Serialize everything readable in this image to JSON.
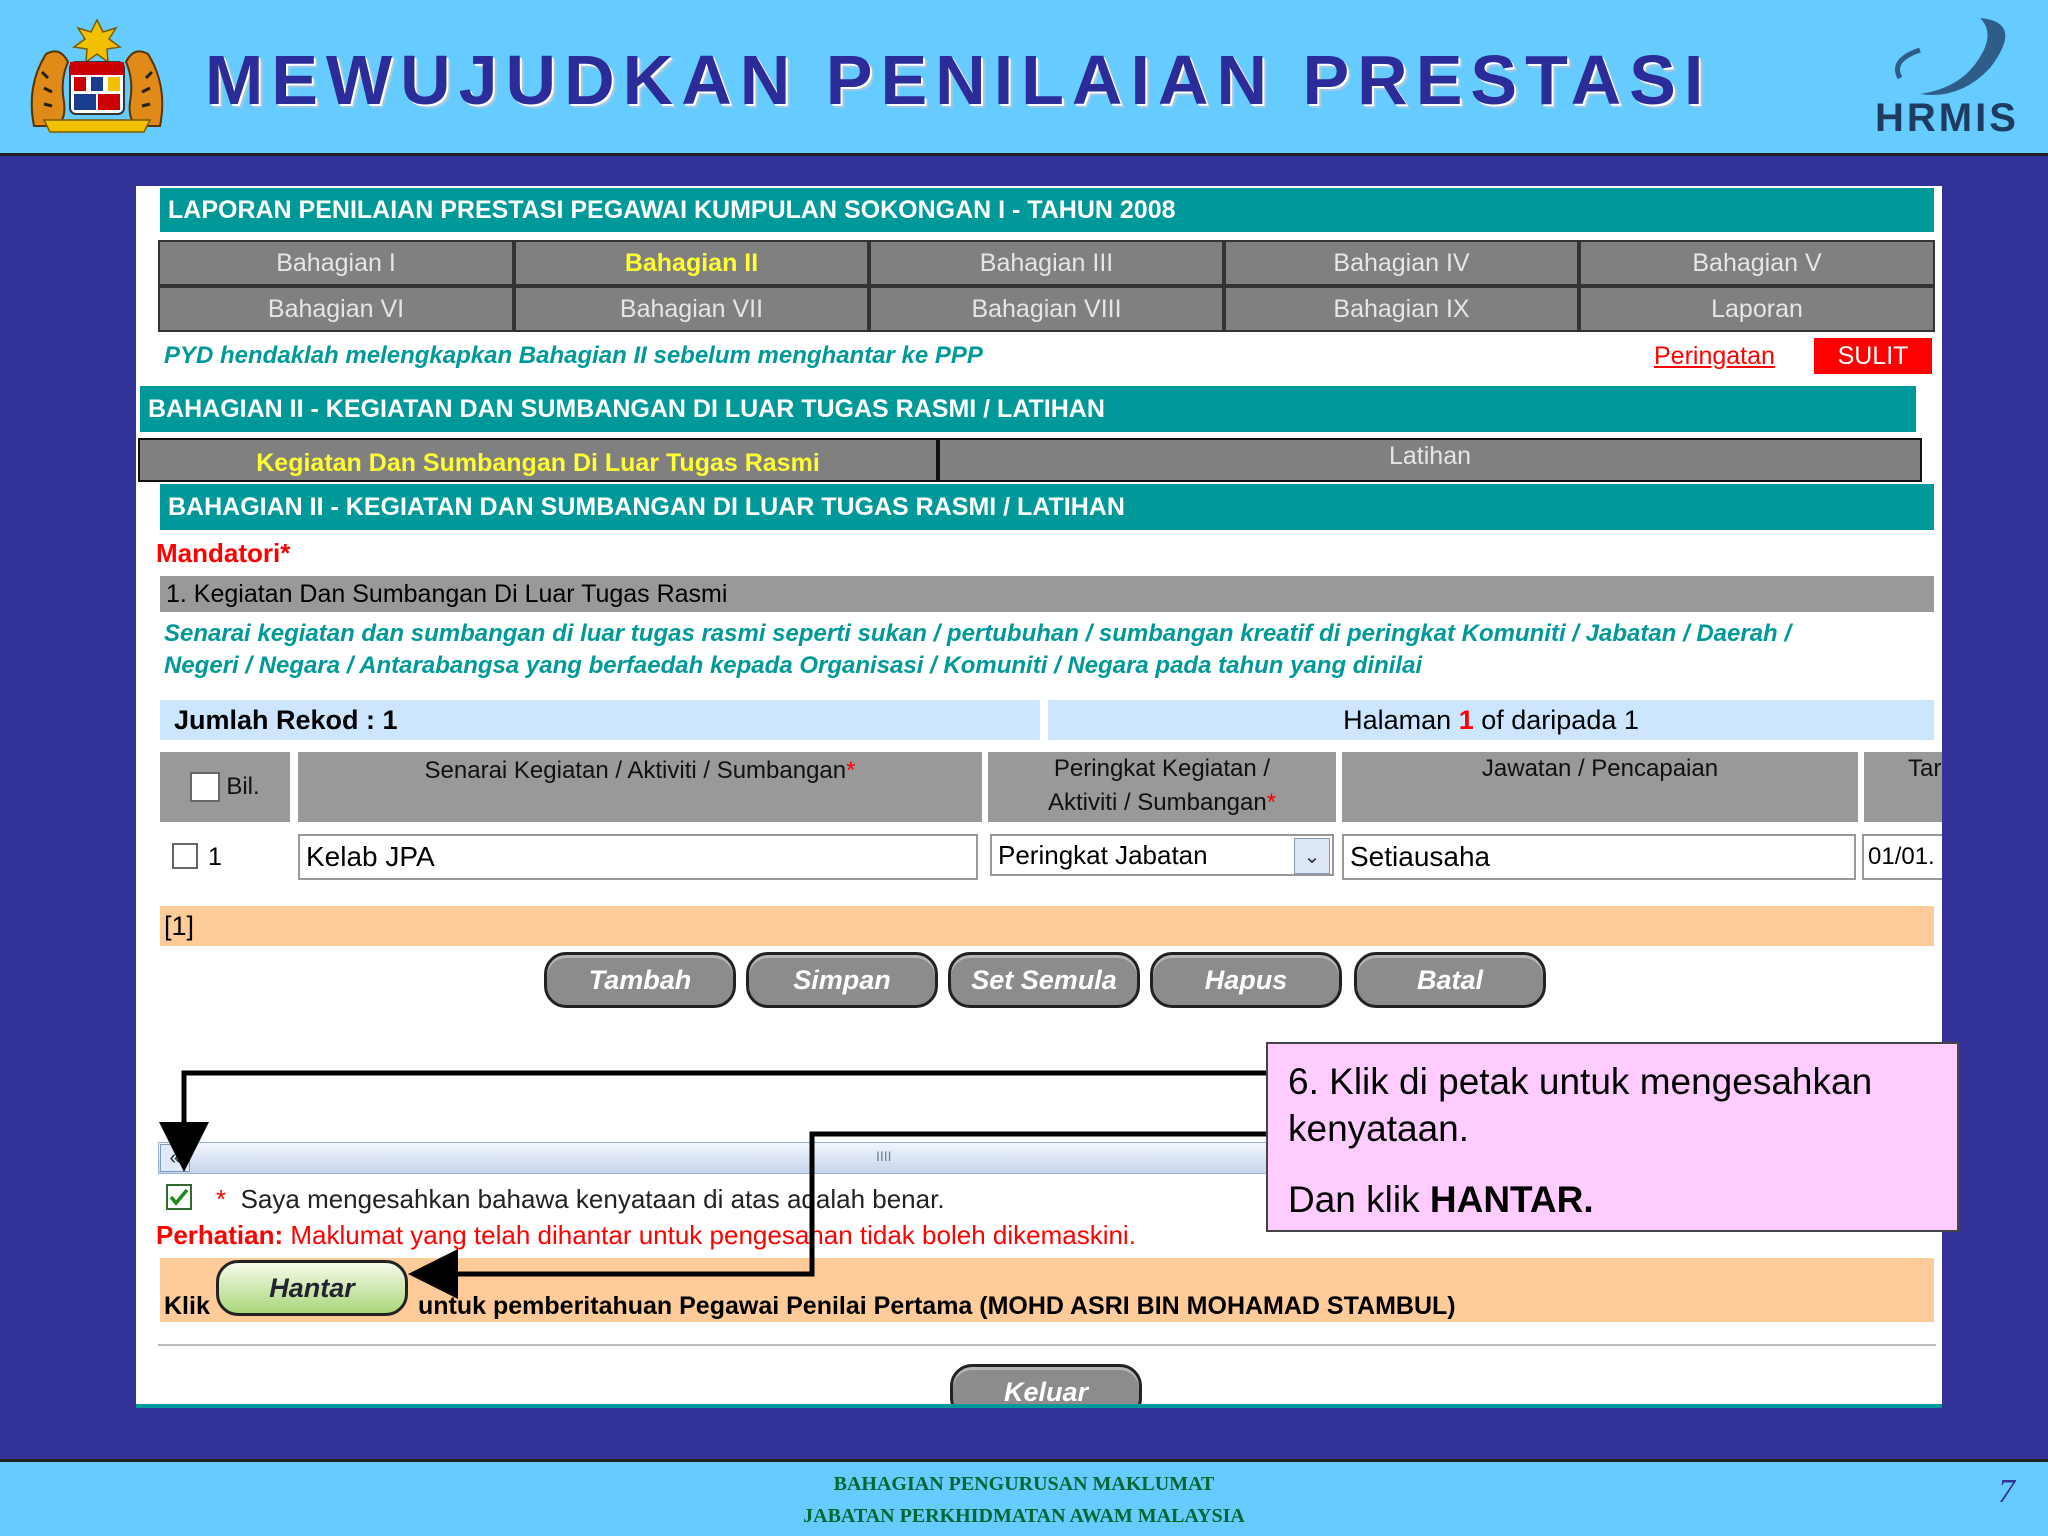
{
  "slide": {
    "title": "MEWUJUDKAN PENILAIAN PRESTASI",
    "logo_right": "HRMIS",
    "footer_line1": "BAHAGIAN PENGURUSAN MAKLUMAT",
    "footer_line2": "JABATAN PERKHIDMATAN AWAM MALAYSIA",
    "page_number": "7"
  },
  "form": {
    "main_title": "LAPORAN PENILAIAN PRESTASI PEGAWAI KUMPULAN SOKONGAN I - TAHUN 2008",
    "tabs_row1": [
      "Bahagian I",
      "Bahagian II",
      "Bahagian III",
      "Bahagian IV",
      "Bahagian V"
    ],
    "tabs_row2": [
      "Bahagian VI",
      "Bahagian VII",
      "Bahagian VIII",
      "Bahagian IX",
      "Laporan"
    ],
    "instruction": "PYD hendaklah melengkapkan Bahagian II sebelum menghantar ke PPP",
    "peringatan_link": "Peringatan",
    "sulit_label": "SULIT",
    "section_header": "BAHAGIAN II - KEGIATAN DAN SUMBANGAN DI LUAR TUGAS RASMI / LATIHAN",
    "subtabs": [
      "Kegiatan Dan Sumbangan Di Luar Tugas Rasmi",
      "Latihan"
    ],
    "section_header2": "BAHAGIAN II - KEGIATAN DAN SUMBANGAN DI LUAR TUGAS RASMI / LATIHAN",
    "mandatori": "Mandatori*",
    "subsection_title": "1. Kegiatan Dan Sumbangan Di Luar Tugas Rasmi",
    "description_line1": "Senarai kegiatan dan sumbangan di luar tugas rasmi seperti sukan / pertubuhan / sumbangan kreatif di peringkat Komuniti / Jabatan / Daerah /",
    "description_line2": "Negeri / Negara / Antarabangsa yang berfaedah kepada Organisasi / Komuniti / Negara pada tahun yang dinilai",
    "record_count": "Jumlah Rekod : 1",
    "pagination_pre": "Halaman",
    "pagination_current": "1",
    "pagination_post": "of daripada 1",
    "table": {
      "col_bil": "Bil.",
      "col_senarai": "Senarai Kegiatan / Aktiviti / Sumbangan",
      "col_peringkat_1": "Peringkat Kegiatan /",
      "col_peringkat_2": "Aktiviti / Sumbangan",
      "col_jawatan": "Jawatan / Pencapaian",
      "col_tarikh_partial": "Tar",
      "required_mark": "*",
      "row": {
        "bil": "1",
        "senarai": "Kelab JPA",
        "peringkat": "Peringkat Jabatan",
        "jawatan": "Setiausaha",
        "tarikh_partial": "01/01."
      }
    },
    "page_link": "[1]",
    "buttons": {
      "tambah": "Tambah",
      "simpan": "Simpan",
      "set_semula": "Set Semula",
      "hapus": "Hapus",
      "batal": "Batal",
      "hantar": "Hantar",
      "keluar": "Keluar"
    },
    "scrollbar_grip": "IIII",
    "confirm_star": "*",
    "confirm_text": "Saya mengesahkan bahawa kenyataan di atas adalah benar.",
    "perhatian_label": "Perhatian:",
    "perhatian_text": "Maklumat yang telah dihantar untuk pengesahan tidak boleh dikemaskini.",
    "klik_label": "Klik",
    "submit_text": "untuk pemberitahuan Pegawai Penilai Pertama (MOHD ASRI BIN MOHAMAD STAMBUL)"
  },
  "callout": {
    "line1": "6. Klik di petak untuk mengesahkan kenyataan.",
    "line2_pre": "Dan klik",
    "line2_bold": "HANTAR."
  }
}
